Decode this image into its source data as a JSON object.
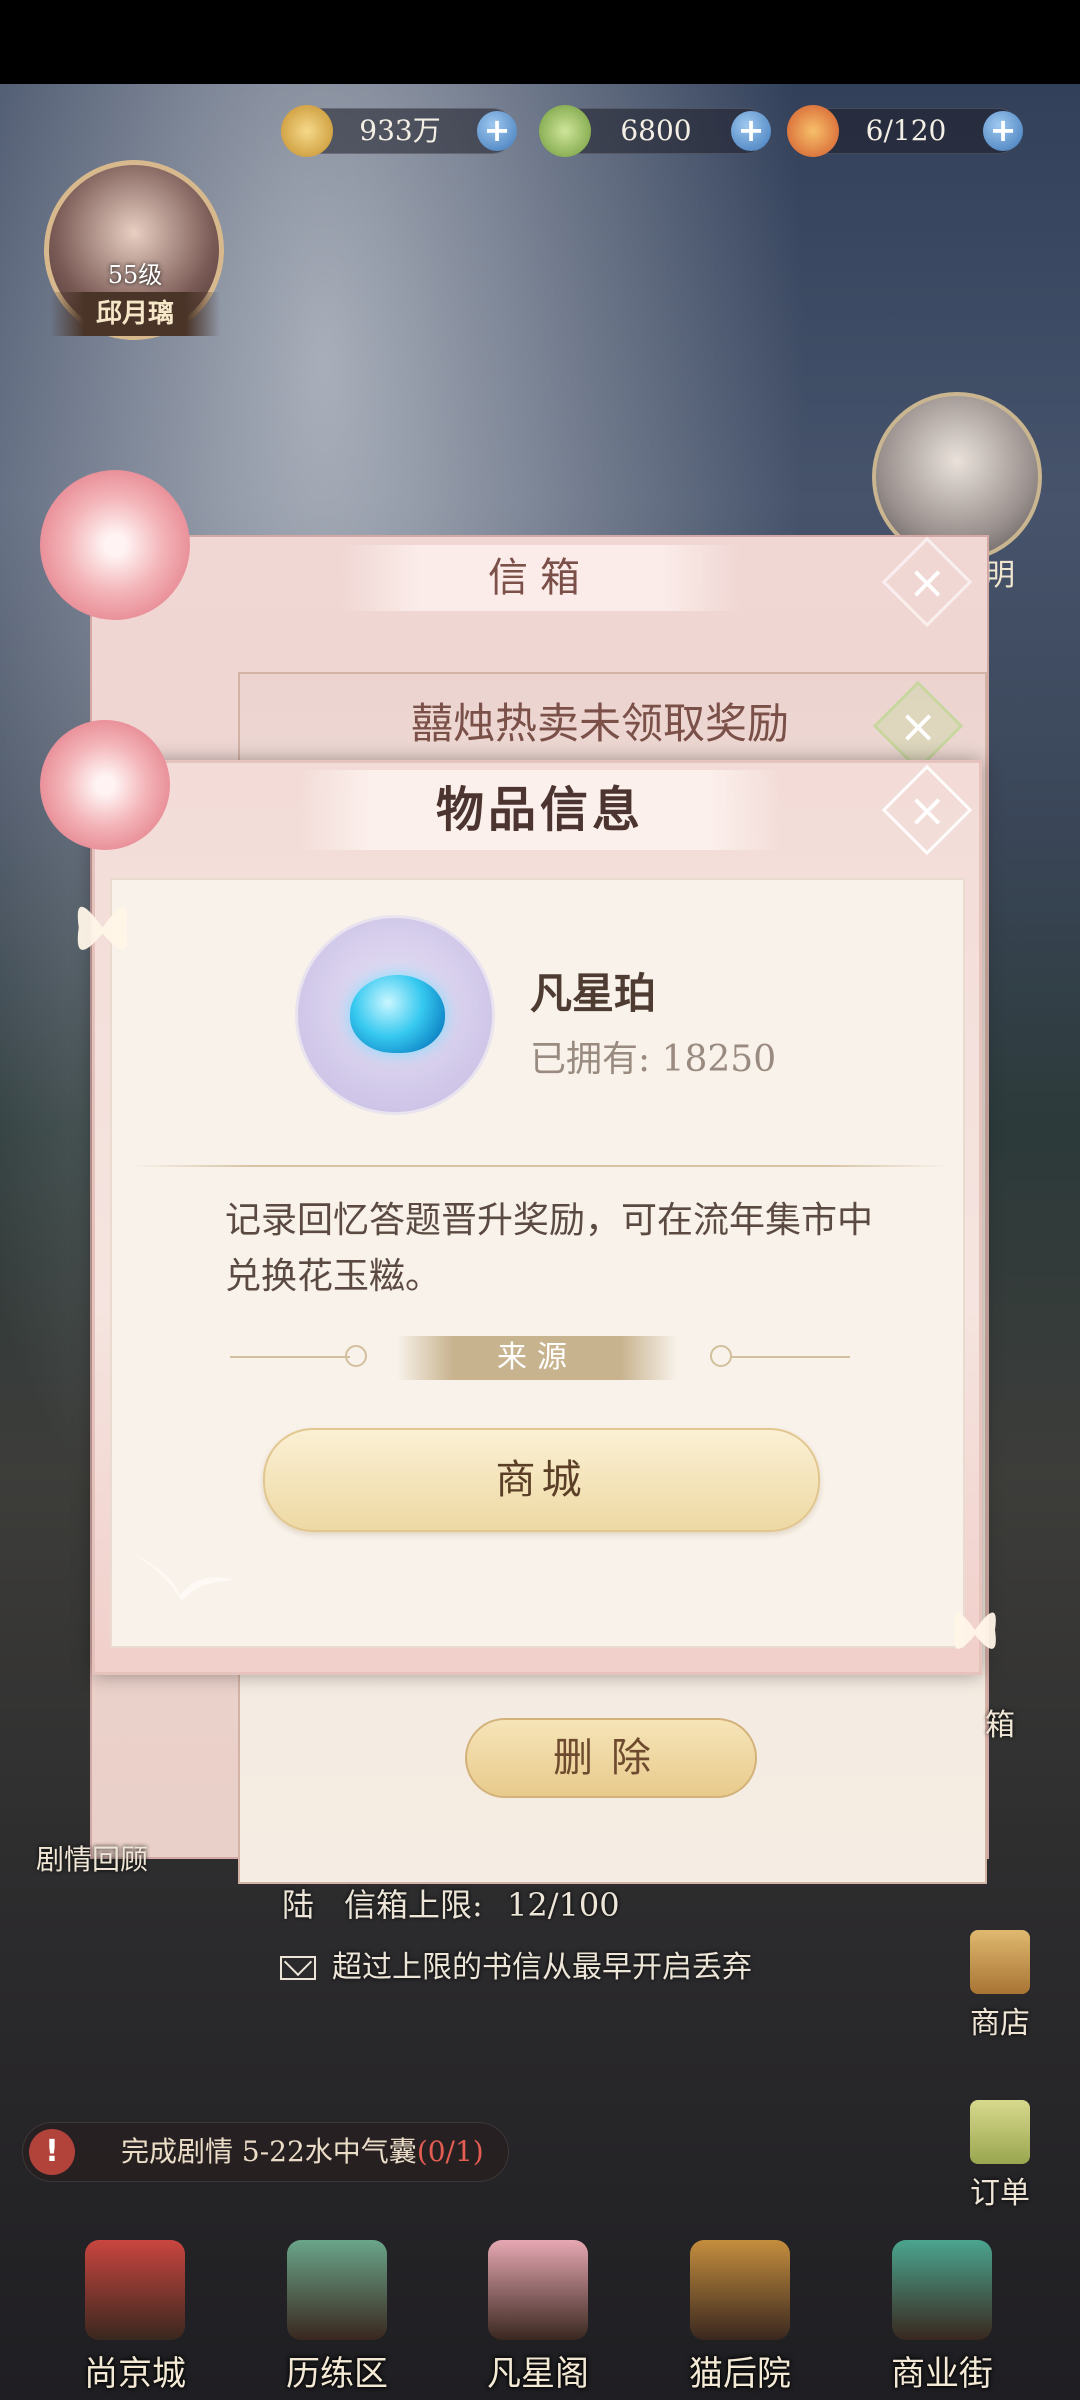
{
  "hud": {
    "coins": "933万",
    "jade": "6800",
    "stamina": "6/120"
  },
  "player": {
    "level": "55级",
    "name": "邱月璃"
  },
  "npc": {
    "name_fragment": "明"
  },
  "mailbox": {
    "title": "信箱",
    "reward_title": "囍烛热卖未领取奖励",
    "delete_label": "删除",
    "limit_label": "陆",
    "limit_text": "信箱上限:",
    "limit_value": "12/100",
    "tip": "超过上限的书信从最早开启丢弃"
  },
  "item_info": {
    "title": "物品信息",
    "name": "凡星珀",
    "owned": "已拥有: 18250",
    "description": "记录回忆答题晋升奖励，可在流年集市中兑换花玉糍。",
    "source_label": "来源",
    "source_button": "商城"
  },
  "left": {
    "review_label": "剧情回顾"
  },
  "task": {
    "text": "完成剧情 5-22水中气囊",
    "progress": "(0/1)"
  },
  "right": {
    "partial": "箱",
    "shop": "商店",
    "order": "订单"
  },
  "nav": [
    {
      "label": "尚京城",
      "icon": "palace-icon",
      "color": "#c9463f"
    },
    {
      "label": "历练区",
      "icon": "mountain-icon",
      "color": "#6aa58a"
    },
    {
      "label": "凡星阁",
      "icon": "blossom-tree-icon",
      "color": "#e7a8b3"
    },
    {
      "label": "猫后院",
      "icon": "cat-basket-icon",
      "color": "#c58e3e"
    },
    {
      "label": "商业街",
      "icon": "gate-icon",
      "color": "#4aa58f"
    }
  ],
  "colors": {
    "dialog_pink": "#f3dcd8",
    "accent_gold": "#e8cb8c",
    "text_brown": "#4e3c33",
    "alert_red": "#e35d52"
  }
}
